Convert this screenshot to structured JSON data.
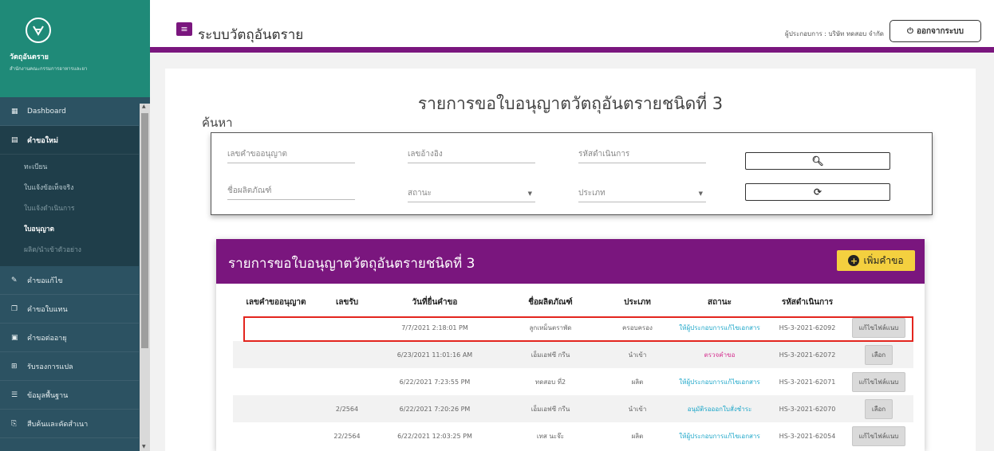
{
  "sidebar": {
    "org_name": "วัตถุอันตราย",
    "org_sub": "สำนักงานคณะกรรมการอาหารและยา",
    "items": [
      {
        "label": "Dashboard",
        "icon": "grid-icon"
      },
      {
        "label": "คำขอใหม่",
        "icon": "document-icon"
      },
      {
        "label": "คำขอแก้ไข",
        "icon": "edit-icon"
      },
      {
        "label": "คำขอใบแทน",
        "icon": "copy-icon"
      },
      {
        "label": "คำขอต่ออายุ",
        "icon": "renew-icon"
      },
      {
        "label": "รับรองการแปล",
        "icon": "translate-icon"
      },
      {
        "label": "ข้อมูลพื้นฐาน",
        "icon": "list-icon"
      },
      {
        "label": "สืบค้นและคัดสำเนา",
        "icon": "search-copy-icon"
      }
    ],
    "sub_items": [
      {
        "label": "ทะเบียน"
      },
      {
        "label": "ใบแจ้งข้อเท็จจริง"
      },
      {
        "label": "ใบแจ้งดำเนินการ"
      },
      {
        "label": "ใบอนุญาต"
      },
      {
        "label": "ผลิต/นำเข้าตัวอย่าง"
      }
    ]
  },
  "header": {
    "app_title": "ระบบวัตถุอันตราย",
    "operator": "ผู้ประกอบการ : บริษัท ทดสอบ จำกัด",
    "logout_label": "ออกจากระบบ"
  },
  "page": {
    "title": "รายการขอใบอนุญาตวัตถุอันตรายชนิดที่ 3",
    "search_label": "ค้นหา"
  },
  "search": {
    "request_no": "เลขคำขออนุญาต",
    "reference_no": "เลขอ้างอิง",
    "operation_code": "รหัสดำเนินการ",
    "product_name": "ชื่อผลิตภัณฑ์",
    "status": "สถานะ",
    "type": "ประเภท"
  },
  "card": {
    "title": "รายการขอใบอนุญาตวัตถุอันตรายชนิดที่ 3",
    "add_label": "เพิ่มคำขอ"
  },
  "table": {
    "headers": [
      "เลขคำขออนุญาต",
      "เลขรับ",
      "วันที่ยื่นคำขอ",
      "ชื่อผลิตภัณฑ์",
      "ประเภท",
      "สถานะ",
      "รหัสดำเนินการ",
      ""
    ],
    "rows": [
      {
        "req": "",
        "recv": "",
        "date": "7/7/2021 2:18:01 PM",
        "product": "ลูกเหม็นตราพัด",
        "type": "ครอบครอง",
        "status": "ให้ผู้ประกอบการแก้ไขเอกสาร",
        "code": "HS-3-2021-62092",
        "action": "แก้ไขไฟล์แนบ"
      },
      {
        "req": "",
        "recv": "",
        "date": "6/23/2021 11:01:16 AM",
        "product": "เอ็มเอฟซี กรีน",
        "type": "นำเข้า",
        "status": "ตรวจคำขอ",
        "code": "HS-3-2021-62072",
        "action": "เลือก"
      },
      {
        "req": "",
        "recv": "",
        "date": "6/22/2021 7:23:55 PM",
        "product": "ทดสอบ ที่2",
        "type": "ผลิต",
        "status": "ให้ผู้ประกอบการแก้ไขเอกสาร",
        "code": "HS-3-2021-62071",
        "action": "แก้ไขไฟล์แนบ"
      },
      {
        "req": "",
        "recv": "2/2564",
        "date": "6/22/2021 7:20:26 PM",
        "product": "เอ็มเอฟซี กรีน",
        "type": "นำเข้า",
        "status": "อนุมัติรอออกใบสั่งชำระ",
        "code": "HS-3-2021-62070",
        "action": "เลือก"
      },
      {
        "req": "",
        "recv": "22/2564",
        "date": "6/22/2021 12:03:25 PM",
        "product": "เทส นะจ๊ะ",
        "type": "ผลิต",
        "status": "ให้ผู้ประกอบการแก้ไขเอกสาร",
        "code": "HS-3-2021-62054",
        "action": "แก้ไขไฟล์แนบ"
      }
    ]
  }
}
